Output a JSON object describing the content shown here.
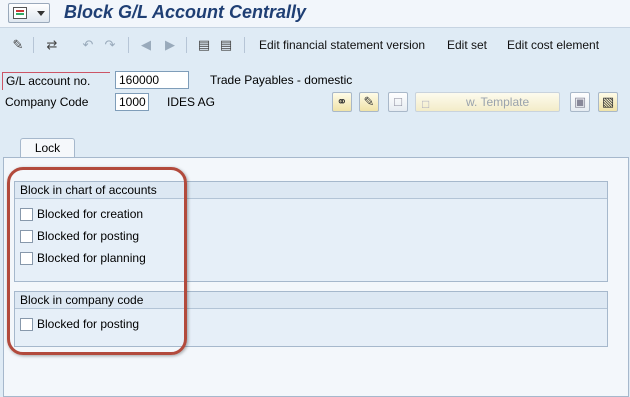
{
  "window": {
    "title": "Block G/L Account Centrally"
  },
  "toolbar": {
    "icons": [
      "change-display-icon",
      "other-account-icon",
      "undo-icon",
      "redo-icon",
      "previous-icon",
      "next-icon",
      "chart-of-accounts-icon",
      "documentation-icon"
    ],
    "edit_fin_statement_label": "Edit financial statement version",
    "edit_set_label": "Edit set",
    "edit_cost_element_label": "Edit cost element"
  },
  "header": {
    "gl_account_label": "G/L account no.",
    "gl_account_value": "160000",
    "gl_account_desc": "Trade Payables - domestic",
    "company_code_label": "Company Code",
    "company_code_value": "1000",
    "company_name": "IDES AG",
    "template_button_label": "w. Template"
  },
  "tabs": [
    {
      "label": "Lock"
    }
  ],
  "lock": {
    "coa_group_title": "Block in chart of accounts",
    "coa_items": [
      {
        "label": "Blocked for creation",
        "checked": false
      },
      {
        "label": "Blocked for posting",
        "checked": false
      },
      {
        "label": "Blocked for planning",
        "checked": false
      }
    ],
    "cc_group_title": "Block in company code",
    "cc_items": [
      {
        "label": "Blocked for posting",
        "checked": false
      }
    ]
  },
  "colors": {
    "title": "#1f3f74",
    "highlight_ring": "#b24a3c",
    "background": "#dfebf5"
  }
}
